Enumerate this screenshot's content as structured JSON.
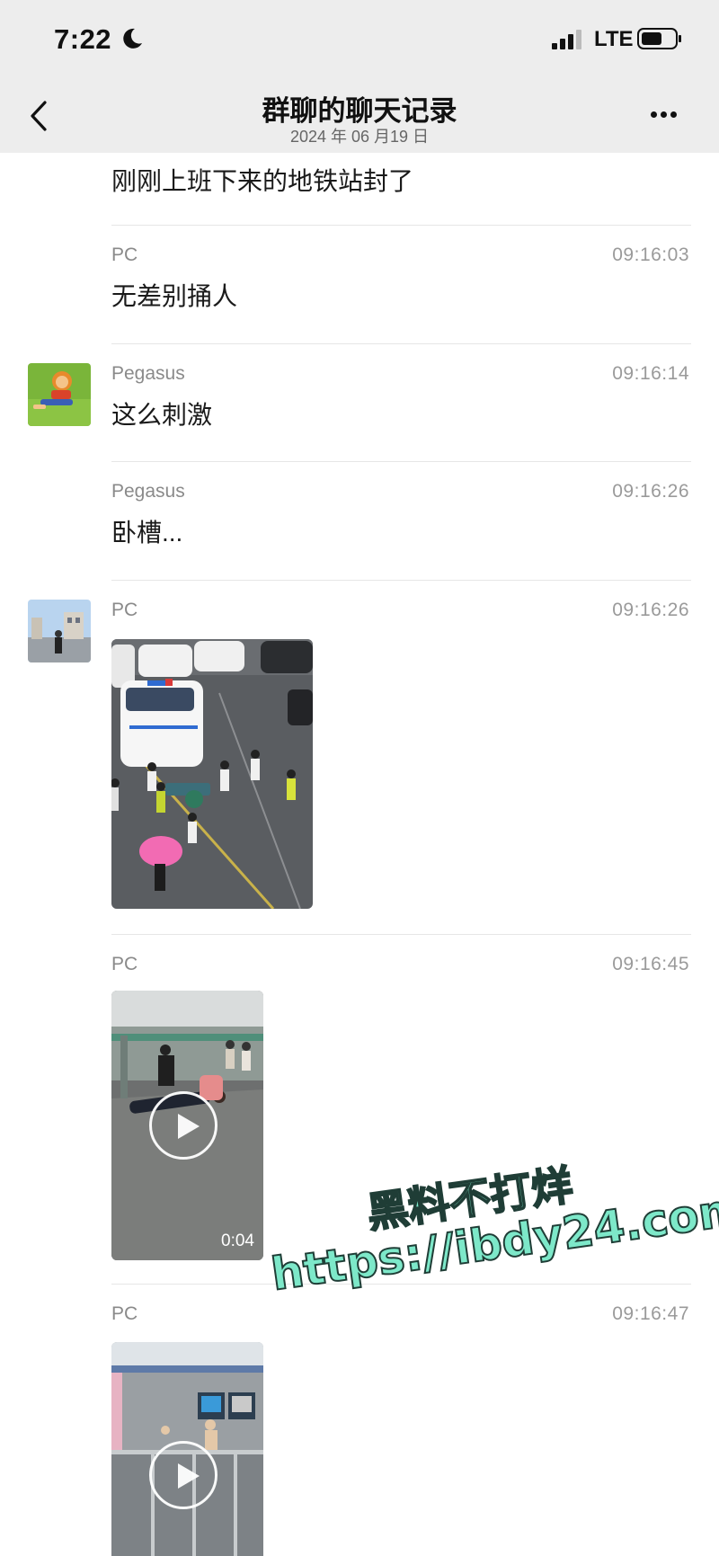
{
  "status_bar": {
    "time": "7:22",
    "network": "LTE"
  },
  "nav": {
    "title": "群聊的聊天记录",
    "subtitle": "2024 年 06 月19 日"
  },
  "messages": [
    {
      "text": "刚刚上班下来的地铁站封了"
    },
    {
      "sender": "PC",
      "time": "09:16:03",
      "text": "无差别捅人"
    },
    {
      "sender": "Pegasus",
      "time": "09:16:14",
      "text": "这么刺激"
    },
    {
      "sender": "Pegasus",
      "time": "09:16:26",
      "text": "卧槽..."
    },
    {
      "sender": "PC",
      "time": "09:16:26",
      "media": "image"
    },
    {
      "sender": "PC",
      "time": "09:16:45",
      "media": "video",
      "duration": "0:04"
    },
    {
      "sender": "PC",
      "time": "09:16:47",
      "media": "video"
    }
  ],
  "watermark": {
    "line1": "黑料不打烊",
    "line2": "https://ibdy24.com"
  },
  "colors": {
    "bar_bg": "#ededed",
    "divider": "#e6e6e6",
    "watermark": "#7de8c9"
  }
}
